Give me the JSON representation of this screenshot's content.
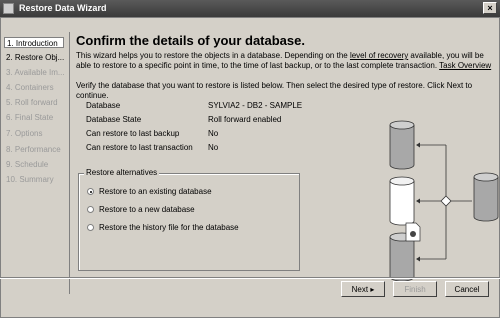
{
  "window": {
    "title": "Restore Data Wizard",
    "close_glyph": "×"
  },
  "sidebar": {
    "steps": [
      {
        "label": "1. Introduction",
        "state": "active"
      },
      {
        "label": "2. Restore Obj...",
        "state": "enabled"
      },
      {
        "label": "3. Available Im...",
        "state": "disabled"
      },
      {
        "label": "4. Containers",
        "state": "disabled"
      },
      {
        "label": "5. Roll forward",
        "state": "disabled"
      },
      {
        "label": "6. Final State",
        "state": "disabled"
      },
      {
        "label": "7. Options",
        "state": "disabled"
      },
      {
        "label": "8. Performance",
        "state": "disabled"
      },
      {
        "label": "9. Schedule",
        "state": "disabled"
      },
      {
        "label": "10. Summary",
        "state": "disabled"
      }
    ]
  },
  "main": {
    "heading": "Confirm the details of your database.",
    "intro_part1": "This wizard helps you to restore the objects in a database. Depending on the ",
    "intro_link1": "level of recovery",
    "intro_part2": " available, you will be able to restore to a specific point in time, to the time of last backup, or to the last complete transaction. ",
    "intro_link2": "Task Overview",
    "verify_text": "Verify the database that you want to restore is listed below. Then select the desired type of restore. Click Next to continue.",
    "details": [
      {
        "label": "Database",
        "value": "SYLVIA2 - DB2 - SAMPLE"
      },
      {
        "label": "Database State",
        "value": "Roll forward enabled"
      },
      {
        "label": "Can restore to last backup",
        "value": "No"
      },
      {
        "label": "Can restore to last transaction",
        "value": "No"
      }
    ],
    "restore_alternatives": {
      "legend": "Restore alternatives",
      "options": [
        {
          "label": "Restore to an existing database",
          "checked": true
        },
        {
          "label": "Restore to a new database",
          "checked": false
        },
        {
          "label": "Restore the history file for the database",
          "checked": false
        }
      ]
    }
  },
  "buttons": {
    "next": "Next ▸",
    "finish": "Finish",
    "cancel": "Cancel"
  },
  "diagram": {
    "icons": [
      "database-icon",
      "history-file-icon"
    ]
  }
}
